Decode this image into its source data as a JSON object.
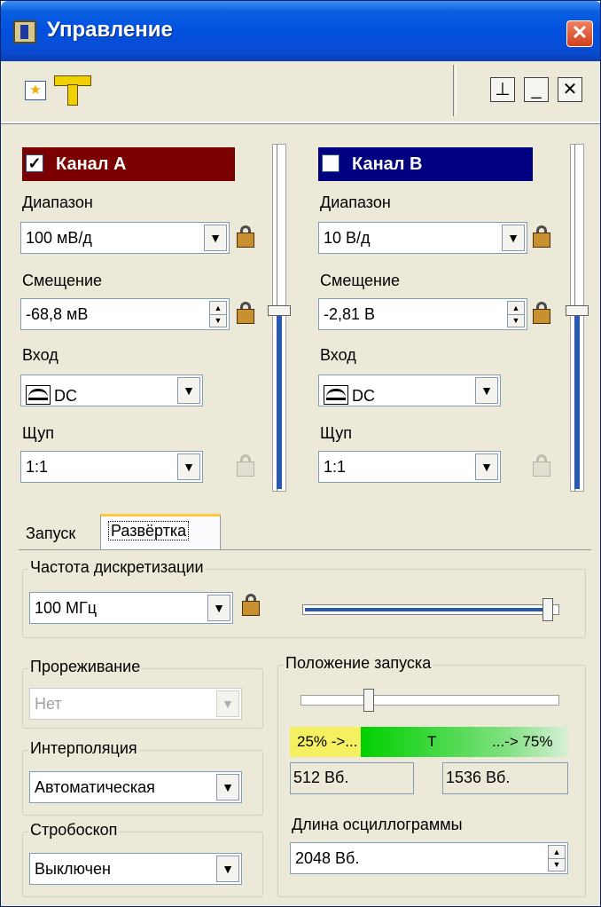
{
  "window": {
    "title": "Управление",
    "close_glyph": "✕",
    "colors": {
      "titlebar": "#0050e0",
      "face": "#ece9d8",
      "channel_a": "#7b0000",
      "channel_b": "#000080",
      "slider_fill": "#2858b0"
    }
  },
  "toolbar": {
    "left_icons": [
      "star-icon",
      "ruler-icon"
    ],
    "right_buttons": [
      {
        "name": "pin-icon",
        "glyph": "⊥"
      },
      {
        "name": "minimize-icon",
        "glyph": "_"
      },
      {
        "name": "close-icon",
        "glyph": "✕"
      }
    ]
  },
  "channels": [
    {
      "title": "Канал А",
      "enabled": true,
      "check_glyph": "✓",
      "color": "#7b0000",
      "range_label": "Диапазон",
      "range_value": "100 мВ/д",
      "offset_label": "Смещение",
      "offset_value": "-68,8 мВ",
      "input_label": "Вход",
      "input_value": "DC",
      "probe_label": "Щуп",
      "probe_value": "1:1",
      "offset_level_fraction": 0.52
    },
    {
      "title": "Канал В",
      "enabled": false,
      "check_glyph": "",
      "color": "#000080",
      "range_label": "Диапазон",
      "range_value": "10 В/д",
      "offset_label": "Смещение",
      "offset_value": "-2,81 В",
      "input_label": "Вход",
      "input_value": "DC",
      "probe_label": "Щуп",
      "probe_value": "1:1",
      "offset_level_fraction": 0.52
    }
  ],
  "tabs": [
    {
      "label": "Запуск",
      "active": false
    },
    {
      "label": "Развёртка",
      "active": true
    }
  ],
  "timebase": {
    "sample_rate_group": "Частота дискретизации",
    "sample_rate_value": "100 МГц",
    "sample_rate_slider_fraction": 0.98,
    "decimation_group": "Прореживание",
    "decimation_value": "Нет",
    "interpolation_group": "Интерполяция",
    "interpolation_value": "Автоматическая",
    "stroboscope_group": "Стробоскоп",
    "stroboscope_value": "Выключен",
    "trigger_position_group": "Положение запуска",
    "trigger_position_fraction": 0.25,
    "trigger_bar": {
      "left": "25% ->...",
      "center": "T",
      "right": "...-> 75%"
    },
    "pre_trigger": "512 Вб.",
    "post_trigger": "1536 Вб.",
    "record_length_label": "Длина осциллограммы",
    "record_length_value": "2048 Вб."
  }
}
